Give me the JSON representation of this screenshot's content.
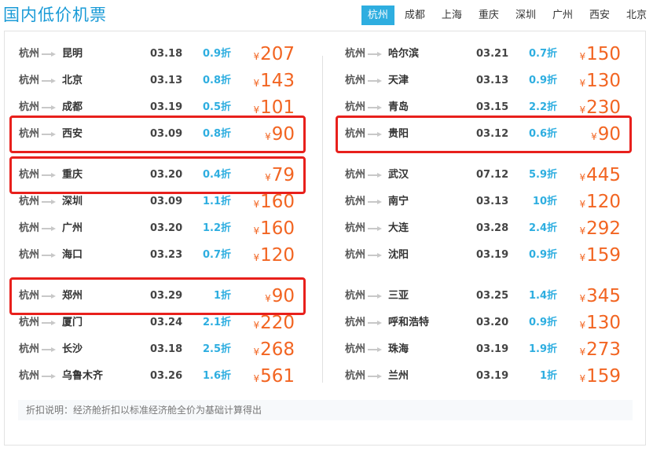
{
  "title": "国内低价机票",
  "tabs": [
    "杭州",
    "成都",
    "上海",
    "重庆",
    "深圳",
    "广州",
    "西安",
    "北京"
  ],
  "active_tab": 0,
  "currency": "¥",
  "left_groups": [
    [
      {
        "from": "杭州",
        "to": "昆明",
        "date": "03.18",
        "discount": "0.9折",
        "price": "207"
      },
      {
        "from": "杭州",
        "to": "北京",
        "date": "03.13",
        "discount": "0.8折",
        "price": "143"
      },
      {
        "from": "杭州",
        "to": "成都",
        "date": "03.19",
        "discount": "0.5折",
        "price": "101"
      },
      {
        "from": "杭州",
        "to": "西安",
        "date": "03.09",
        "discount": "0.8折",
        "price": "90",
        "highlight": true
      }
    ],
    [
      {
        "from": "杭州",
        "to": "重庆",
        "date": "03.20",
        "discount": "0.4折",
        "price": "79",
        "highlight": true
      },
      {
        "from": "杭州",
        "to": "深圳",
        "date": "03.09",
        "discount": "1.1折",
        "price": "160"
      },
      {
        "from": "杭州",
        "to": "广州",
        "date": "03.20",
        "discount": "1.2折",
        "price": "160"
      },
      {
        "from": "杭州",
        "to": "海口",
        "date": "03.23",
        "discount": "0.7折",
        "price": "120"
      }
    ],
    [
      {
        "from": "杭州",
        "to": "郑州",
        "date": "03.29",
        "discount": "1折",
        "price": "90",
        "highlight": true
      },
      {
        "from": "杭州",
        "to": "厦门",
        "date": "03.24",
        "discount": "2.1折",
        "price": "220"
      },
      {
        "from": "杭州",
        "to": "长沙",
        "date": "03.18",
        "discount": "2.5折",
        "price": "268"
      },
      {
        "from": "杭州",
        "to": "乌鲁木齐",
        "date": "03.26",
        "discount": "1.6折",
        "price": "561"
      }
    ]
  ],
  "right_groups": [
    [
      {
        "from": "杭州",
        "to": "哈尔滨",
        "date": "03.21",
        "discount": "0.7折",
        "price": "150"
      },
      {
        "from": "杭州",
        "to": "天津",
        "date": "03.13",
        "discount": "0.9折",
        "price": "130"
      },
      {
        "from": "杭州",
        "to": "青岛",
        "date": "03.15",
        "discount": "2.2折",
        "price": "230"
      },
      {
        "from": "杭州",
        "to": "贵阳",
        "date": "03.12",
        "discount": "0.6折",
        "price": "90",
        "highlight": true
      }
    ],
    [
      {
        "from": "杭州",
        "to": "武汉",
        "date": "07.12",
        "discount": "5.9折",
        "price": "445"
      },
      {
        "from": "杭州",
        "to": "南宁",
        "date": "03.13",
        "discount": "10折",
        "price": "120"
      },
      {
        "from": "杭州",
        "to": "大连",
        "date": "03.28",
        "discount": "2.4折",
        "price": "292"
      },
      {
        "from": "杭州",
        "to": "沈阳",
        "date": "03.19",
        "discount": "0.9折",
        "price": "159"
      }
    ],
    [
      {
        "from": "杭州",
        "to": "三亚",
        "date": "03.25",
        "discount": "1.4折",
        "price": "345"
      },
      {
        "from": "杭州",
        "to": "呼和浩特",
        "date": "03.20",
        "discount": "0.9折",
        "price": "130"
      },
      {
        "from": "杭州",
        "to": "珠海",
        "date": "03.19",
        "discount": "1.9折",
        "price": "273"
      },
      {
        "from": "杭州",
        "to": "兰州",
        "date": "03.19",
        "discount": "1折",
        "price": "159"
      }
    ]
  ],
  "note": "折扣说明：经济舱折扣以标准经济舱全价为基础计算得出",
  "colors": {
    "accent": "#2eaee0",
    "title": "#1a9bd7",
    "price": "#f26522",
    "highlight": "#e8201c"
  }
}
